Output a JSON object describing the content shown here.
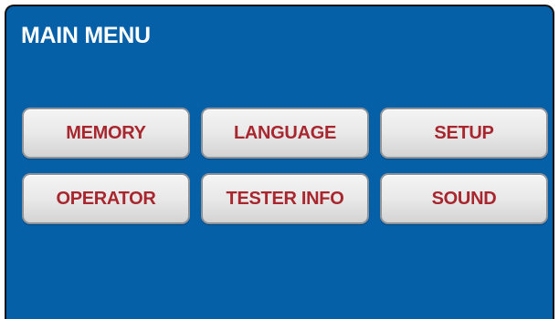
{
  "screen": {
    "title": "MAIN MENU",
    "background_color": "#0560a8",
    "button_text_color": "#a8262e"
  },
  "menu": {
    "buttons": [
      {
        "label": "MEMORY"
      },
      {
        "label": "LANGUAGE"
      },
      {
        "label": "SETUP"
      },
      {
        "label": "OPERATOR"
      },
      {
        "label": "TESTER INFO"
      },
      {
        "label": "SOUND"
      }
    ]
  }
}
